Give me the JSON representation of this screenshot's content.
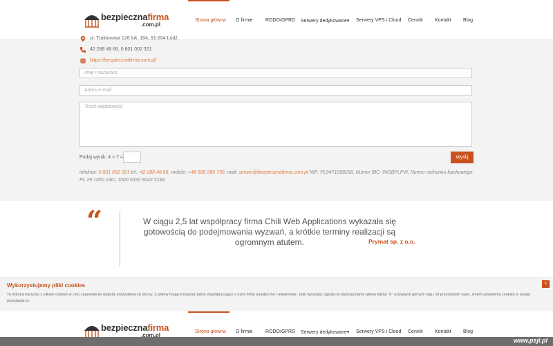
{
  "header": {
    "logo": {
      "main": "bezpieczna",
      "accent": "firma",
      "sub": ".com.pl"
    },
    "nav": [
      {
        "label": "Strona główna",
        "active": true
      },
      {
        "label": "O firmie",
        "active": false
      },
      {
        "label": "RODO/GPRD",
        "active": false
      },
      {
        "label": "Serwery dedykowane▾",
        "active": false
      },
      {
        "label": "Serwery VPS i Cloud",
        "active": false
      },
      {
        "label": "Cennik",
        "active": false
      },
      {
        "label": "Kontakt",
        "active": false
      },
      {
        "label": "Blog",
        "active": false
      }
    ]
  },
  "contact": {
    "address": "ul. Traktorowa 126 lok. 104, 91-204 Łódź",
    "phones": "42 288 48 66, 0 801 002 321",
    "website": "https://bezpiecznafirma.com.pl/",
    "form": {
      "name_placeholder": "Imię i nazwisko",
      "email_placeholder": "Adres e-mail",
      "message_placeholder": "Treść wiadomości",
      "captcha_label": "Podaj wynik: 4 × 7 =",
      "send_label": "Wyślij"
    },
    "footer": {
      "p1": "infolinia: ",
      "infolinia": "0 801 002 321",
      "p2": " tel.: ",
      "tel": "42 288 48 66",
      "p3": ", mobile: ",
      "mobile": "+48 508 280 730",
      "p4": ", mail: ",
      "mail": "serwis@bezpiecznafirma.com.pl",
      "p5": " NIP: PL9471998296, Numer BIC: INGBPLPW, Numer rachunku bankowego: PL 29 1050 1461 1000 0090 8043 5184"
    }
  },
  "testimonial": {
    "quote_mark": "“",
    "text": "W ciągu 2,5 lat współpracy firma Chili Web Applications wykazała się gotowością do podejmowania wyzwań, a krótkie terminy realizacji są ogromnym atutem.",
    "author": "Prymat sp. z o.o."
  },
  "cookie": {
    "title": "Wykorzystujemy pliki cookies",
    "text": "Ta witryna korzysta z plików cookies w celu zapewnienia wygody korzystania ze strony. Z plików mogą korzystać także współpracujące z nami firmy analityczne i reklamowe. Jeśli wyrażasz zgodę na wykorzystanie plików kliknij \"X\" w prawym górnym rogu. W przeciwnym razie, zmień ustawienia cookies w swojej przeglądarce.",
    "close": "x"
  },
  "watermark": "www.psji.pl",
  "colors": {
    "accent": "#c8511c",
    "section_bg": "#f3f3f3"
  }
}
